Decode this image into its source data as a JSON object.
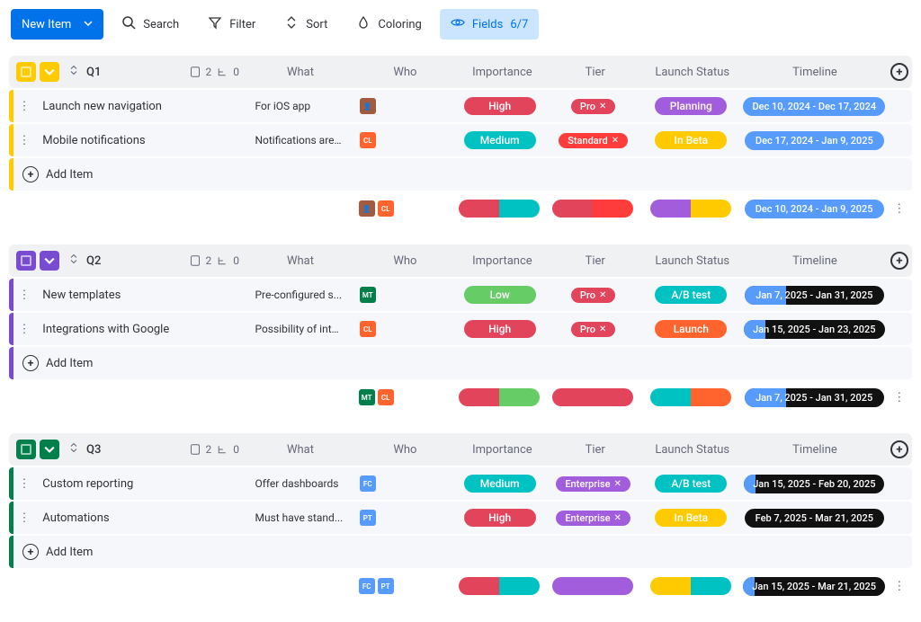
{
  "toolbar": {
    "new_item": "New Item",
    "search": "Search",
    "filter": "Filter",
    "sort": "Sort",
    "coloring": "Coloring",
    "fields": "Fields",
    "fields_count": "6/7"
  },
  "columns": {
    "what": "What",
    "who": "Who",
    "importance": "Importance",
    "tier": "Tier",
    "launch_status": "Launch Status",
    "timeline": "Timeline"
  },
  "add_item": "Add Item",
  "groups": [
    {
      "color": "yellow",
      "title": "Q1",
      "doc_count": "2",
      "children_count": "0",
      "rows": [
        {
          "name": "Launch new navigation",
          "what": "For iOS app",
          "who": [
            {
              "initials": "👤",
              "color": "#a25b3f"
            }
          ],
          "importance": {
            "label": "High",
            "color": "#e2445c"
          },
          "tier": {
            "label": "Pro",
            "color": "#e2445c"
          },
          "launch": {
            "label": "Planning",
            "color": "#a25ddc"
          },
          "timeline": {
            "label": "Dec 10, 2024 - Dec 17, 2024",
            "bg": "#579bfc"
          }
        },
        {
          "name": "Mobile notifications",
          "what": "Notifications are ...",
          "who": [
            {
              "initials": "CL",
              "color": "#ff642e"
            }
          ],
          "importance": {
            "label": "Medium",
            "color": "#00c2c2"
          },
          "tier": {
            "label": "Standard",
            "color": "#ff3c3c"
          },
          "launch": {
            "label": "In Beta",
            "color": "#ffcb00"
          },
          "timeline": {
            "label": "Dec 17, 2024 - Jan 9, 2025",
            "bg": "#579bfc"
          }
        }
      ],
      "summary": {
        "who": [
          {
            "initials": "👤",
            "color": "#a25b3f"
          },
          {
            "initials": "CL",
            "color": "#ff642e"
          }
        ],
        "importance_colors": [
          "#e2445c",
          "#00c2c2"
        ],
        "tier_colors": [
          "#e2445c",
          "#ff3c3c"
        ],
        "launch_colors": [
          "#a25ddc",
          "#ffcb00"
        ],
        "timeline": {
          "label": "Dec 10, 2024 - Jan 9, 2025",
          "bg": "#579bfc"
        }
      }
    },
    {
      "color": "purple",
      "title": "Q2",
      "doc_count": "2",
      "children_count": "0",
      "rows": [
        {
          "name": "New templates",
          "what": "Pre-configured s...",
          "who": [
            {
              "initials": "MT",
              "color": "#037f4c"
            }
          ],
          "importance": {
            "label": "Low",
            "color": "#66cc66"
          },
          "tier": {
            "label": "Pro",
            "color": "#e2445c"
          },
          "launch": {
            "label": "A/B test",
            "color": "#00c2c2"
          },
          "timeline": {
            "label": "Jan 7, 2025 - Jan 31, 2025",
            "split": true,
            "leftColor": "#579bfc",
            "rightColor": "#111",
            "pct": "30%"
          }
        },
        {
          "name": "Integrations with Google",
          "what": "Possibility of inte...",
          "who": [
            {
              "initials": "CL",
              "color": "#ff642e"
            }
          ],
          "importance": {
            "label": "High",
            "color": "#e2445c"
          },
          "tier": {
            "label": "Pro",
            "color": "#e2445c"
          },
          "launch": {
            "label": "Launch",
            "color": "#ff642e"
          },
          "timeline": {
            "label": "Jan 15, 2025 - Jan 23, 2025",
            "split": true,
            "leftColor": "#579bfc",
            "rightColor": "#111",
            "pct": "15%"
          }
        }
      ],
      "summary": {
        "who": [
          {
            "initials": "MT",
            "color": "#037f4c"
          },
          {
            "initials": "CL",
            "color": "#ff642e"
          }
        ],
        "importance_colors": [
          "#e2445c",
          "#66cc66"
        ],
        "tier_colors": [
          "#e2445c",
          "#e2445c"
        ],
        "launch_colors": [
          "#00c2c2",
          "#ff642e"
        ],
        "timeline": {
          "label": "Jan 7, 2025 - Jan 31, 2025",
          "split": true,
          "leftColor": "#579bfc",
          "rightColor": "#111",
          "pct": "30%"
        }
      }
    },
    {
      "color": "teal",
      "title": "Q3",
      "doc_count": "2",
      "children_count": "0",
      "rows": [
        {
          "name": "Custom reporting",
          "what": "Offer dashboards",
          "who": [
            {
              "initials": "FC",
              "color": "#579bfc"
            }
          ],
          "importance": {
            "label": "Medium",
            "color": "#00c2c2"
          },
          "tier": {
            "label": "Enterprise",
            "color": "#a25ddc"
          },
          "launch": {
            "label": "A/B test",
            "color": "#00c2c2"
          },
          "timeline": {
            "label": "Jan 15, 2025 - Feb 20, 2025",
            "split": true,
            "leftColor": "#579bfc",
            "rightColor": "#111",
            "pct": "8%"
          }
        },
        {
          "name": "Automations",
          "what": "Must have stand...",
          "who": [
            {
              "initials": "PT",
              "color": "#579bfc"
            }
          ],
          "importance": {
            "label": "High",
            "color": "#e2445c"
          },
          "tier": {
            "label": "Enterprise",
            "color": "#a25ddc"
          },
          "launch": {
            "label": "In Beta",
            "color": "#ffcb00"
          },
          "timeline": {
            "label": "Feb 7, 2025 - Mar 21, 2025",
            "bg": "#111"
          }
        }
      ],
      "summary": {
        "who": [
          {
            "initials": "FC",
            "color": "#579bfc"
          },
          {
            "initials": "PT",
            "color": "#579bfc"
          }
        ],
        "importance_colors": [
          "#e2445c",
          "#00c2c2"
        ],
        "tier_colors": [
          "#a25ddc",
          "#a25ddc"
        ],
        "launch_colors": [
          "#ffcb00",
          "#00c2c2"
        ],
        "timeline": {
          "label": "Jan 15, 2025 - Mar 21, 2025",
          "split": true,
          "leftColor": "#579bfc",
          "rightColor": "#111",
          "pct": "8%"
        }
      }
    }
  ]
}
